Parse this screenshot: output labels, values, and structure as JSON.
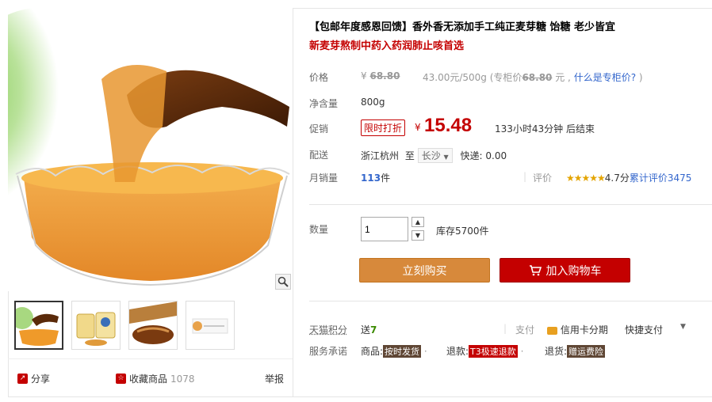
{
  "product": {
    "title": "【包邮年度感恩回馈】香外香无添加手工纯正麦芽糖 饴糖 老少皆宜",
    "subtitle": "新麦芽熬制中药入药润肺止咳首选"
  },
  "price": {
    "label": "价格",
    "currency": "¥",
    "original": "68.80",
    "unit_price": "43.00元/500g",
    "counter_prefix": "(专柜价",
    "counter_price": "68.80",
    "counter_suffix": "元 ,",
    "counter_link": "什么是专柜价?",
    "close_paren": ")"
  },
  "net_weight": {
    "label": "净含量",
    "value": "800g"
  },
  "promo": {
    "label": "促销",
    "tag": "限时打折",
    "currency": "¥",
    "price": "15.48",
    "countdown": "133小时43分钟 后结束"
  },
  "shipping": {
    "label": "配送",
    "origin": "浙江杭州",
    "to": "至",
    "destination": "长沙",
    "fee": "快递: 0.00"
  },
  "sales": {
    "label": "月销量",
    "count": "113",
    "unit": "件",
    "rating_label": "评价",
    "stars": "★★★★★",
    "score": "4.7分",
    "reviews": "累计评价3475"
  },
  "quantity": {
    "label": "数量",
    "value": "1",
    "stock": "库存5700件"
  },
  "buttons": {
    "buy_now": "立刻购买",
    "add_cart": "加入购物车"
  },
  "points": {
    "label": "天猫积分",
    "prefix": "送",
    "value": "7",
    "pay_label": "支付",
    "pay_option1": "信用卡分期",
    "pay_option2": "快捷支付"
  },
  "service": {
    "label": "服务承诺",
    "goods_label": "商品:",
    "goods_tag": "按时发货",
    "refund_label": "退款:",
    "refund_tag": "T3极速退款",
    "return_label": "退货:",
    "return_tag": "赠运费险"
  },
  "share": {
    "share_label": "分享",
    "fav_label": "收藏商品",
    "fav_count": "1078",
    "report_label": "举报"
  },
  "colors": {
    "accent_red": "#c40000",
    "buy_orange": "#d7893b",
    "link_blue": "#3366cc",
    "star_gold": "#e4a400"
  }
}
